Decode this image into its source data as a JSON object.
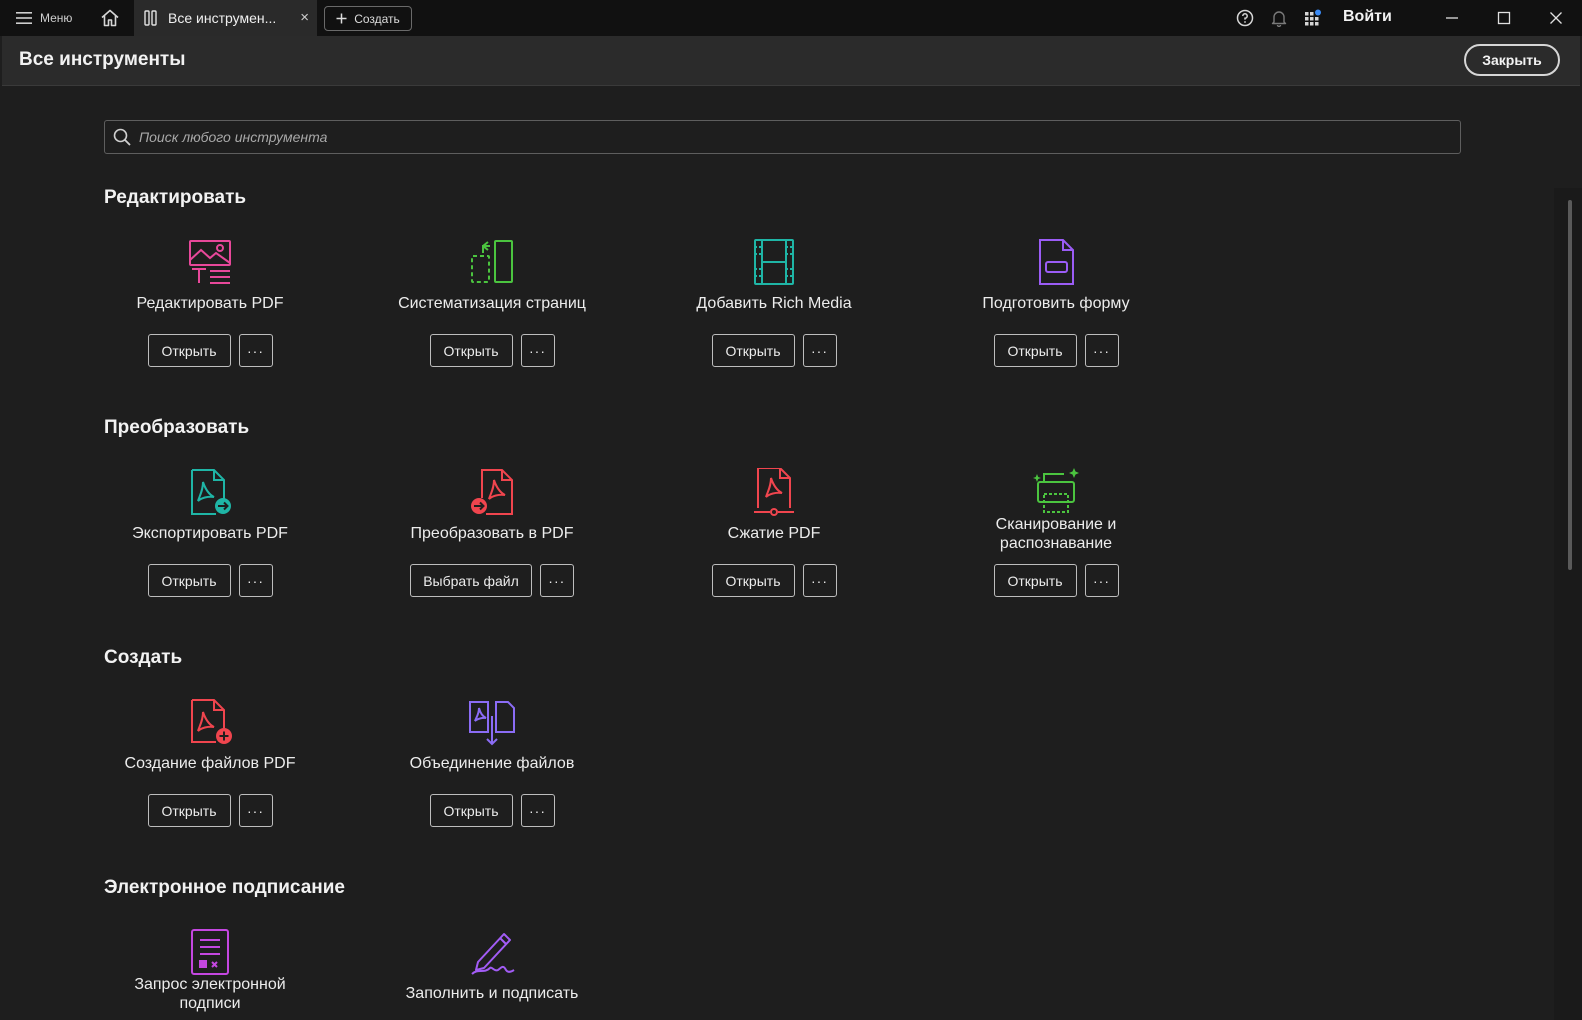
{
  "titlebar": {
    "menu_label": "Меню",
    "tab_label": "Все инструмен...",
    "tab_close": "×",
    "create_label": "Создать",
    "signin_label": "Войти",
    "accent_dot": "#3b8bf5"
  },
  "header": {
    "title": "Все инструменты",
    "close_label": "Закрыть"
  },
  "search": {
    "placeholder": "Поиск любого инструмента"
  },
  "sections": [
    {
      "title": "Редактировать",
      "tools": [
        {
          "label": "Редактировать PDF",
          "button": "Открыть",
          "icon": "edit-pdf-icon",
          "color": "#e8489a"
        },
        {
          "label": "Систематизация страниц",
          "button": "Открыть",
          "icon": "organize-pages-icon",
          "color": "#4bc43f"
        },
        {
          "label": "Добавить Rich Media",
          "button": "Открыть",
          "icon": "rich-media-icon",
          "color": "#1fb5a6"
        },
        {
          "label": "Подготовить форму",
          "button": "Открыть",
          "icon": "prepare-form-icon",
          "color": "#9b5cf5"
        }
      ]
    },
    {
      "title": "Преобразовать",
      "tools": [
        {
          "label": "Экспортировать PDF",
          "button": "Открыть",
          "icon": "export-pdf-icon",
          "color": "#1fb5a6"
        },
        {
          "label": "Преобразовать в PDF",
          "button": "Выбрать файл",
          "icon": "convert-pdf-icon",
          "color": "#f0454e"
        },
        {
          "label": "Сжатие PDF",
          "button": "Открыть",
          "icon": "compress-pdf-icon",
          "color": "#f0454e"
        },
        {
          "label": "Сканирование и распознавание",
          "label_line1": "Сканирование и",
          "label_line2": "распознавание",
          "button": "Открыть",
          "icon": "scan-ocr-icon",
          "color": "#4bc43f"
        }
      ]
    },
    {
      "title": "Создать",
      "tools": [
        {
          "label": "Создание файлов PDF",
          "button": "Открыть",
          "icon": "create-pdf-icon",
          "color": "#f0454e"
        },
        {
          "label": "Объединение файлов",
          "button": "Открыть",
          "icon": "combine-files-icon",
          "color": "#8b6cf5"
        }
      ]
    },
    {
      "title": "Электронное подписание",
      "tools": [
        {
          "label": "Запрос электронной подписи",
          "label_line1": "Запрос электронной",
          "label_line2": "подписи",
          "icon": "request-esign-icon",
          "color": "#c447e0"
        },
        {
          "label": "Заполнить и подписать",
          "icon": "fill-sign-icon",
          "color": "#a25cf5"
        }
      ]
    }
  ],
  "more_label": "···"
}
